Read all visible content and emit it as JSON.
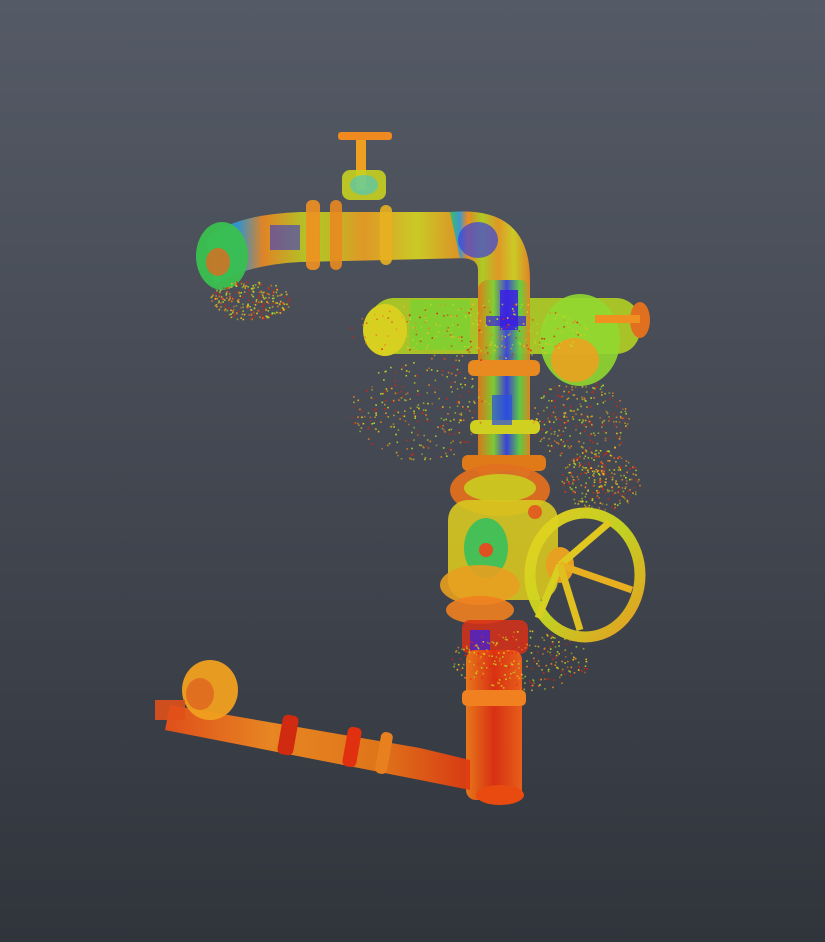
{
  "viewer": {
    "scene_subject": "pipe-assembly-point-cloud",
    "colormap": [
      "#2a10d8",
      "#1aa8e8",
      "#20d060",
      "#b8e020",
      "#f0c020",
      "#f08020",
      "#e02010"
    ]
  }
}
